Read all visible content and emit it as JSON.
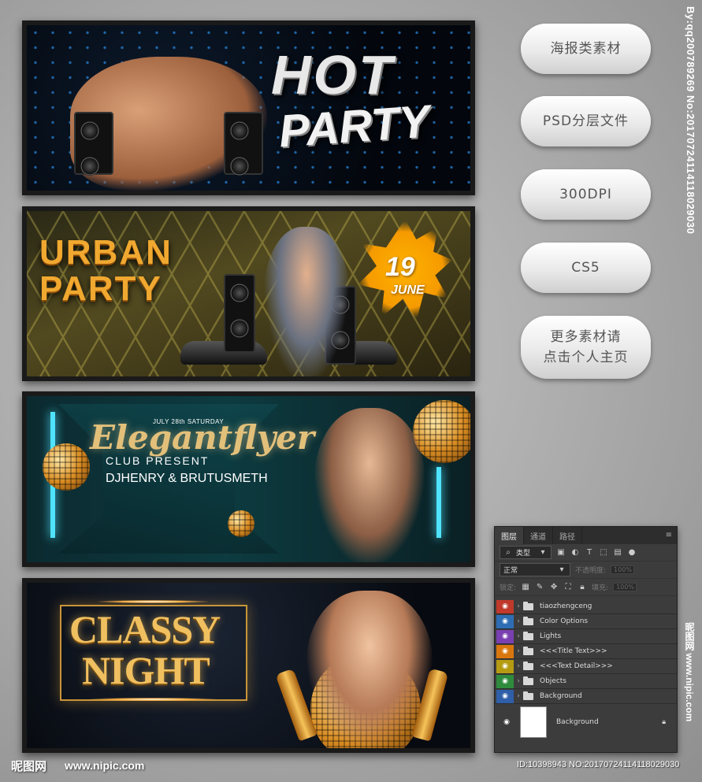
{
  "banners": [
    {
      "headline_1": "HOT",
      "headline_2": "PARTY"
    },
    {
      "headline_1": "URBAN",
      "headline_2": "PARTY",
      "date_day": "19",
      "date_month": "JUNE"
    },
    {
      "small_date": "JULY 28th SATURDAY",
      "script_title": "Elegantflyer",
      "subtitle": "CLUB PRESENT",
      "djs": "DJHENRY & BRUTUSMETH"
    },
    {
      "headline_1": "CLASSY",
      "headline_2": "NIGHT"
    }
  ],
  "side_buttons": [
    {
      "label": "海报类素材"
    },
    {
      "label": "PSD分层文件"
    },
    {
      "label": "300DPI"
    },
    {
      "label": "CS5"
    },
    {
      "label_line1": "更多素材请",
      "label_line2": "点击个人主页"
    }
  ],
  "watermark_vertical": "By:qq200789269 No:20170724114118029030",
  "watermark_vertical_2": "昵图网 www.nipic.com",
  "layers_panel": {
    "tabs": [
      "图层",
      "通道",
      "路径"
    ],
    "filter_label": "类型",
    "blend_mode": "正常",
    "opacity_label": "不透明度:",
    "opacity_value": "100%",
    "lock_label": "锁定:",
    "fill_label": "填充:",
    "fill_value": "100%",
    "layers": [
      {
        "name": "tiaozhengceng",
        "color": "#c0392b"
      },
      {
        "name": "Color Options",
        "color": "#2e6db4"
      },
      {
        "name": "Lights",
        "color": "#7a3fb0"
      },
      {
        "name": "<<<Title Text>>>",
        "color": "#d9770e"
      },
      {
        "name": "<<<Text Detail>>>",
        "color": "#b59b12"
      },
      {
        "name": "Objects",
        "color": "#2e8b3e"
      },
      {
        "name": "Background",
        "color": "#2e5fa8"
      }
    ],
    "background_layer": "Background"
  },
  "footer": {
    "logo": "昵图网",
    "url": "www.nipic.com",
    "id_text": "ID:10398943 NO:20170724114118029030"
  }
}
